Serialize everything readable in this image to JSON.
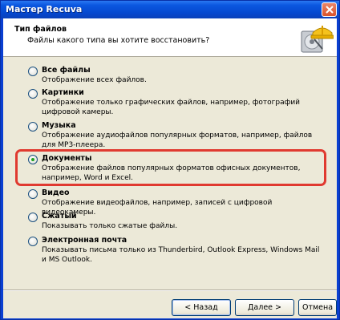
{
  "window": {
    "title": "Мастер Recuva"
  },
  "header": {
    "title": "Тип файлов",
    "subtitle": "Файлы какого типа вы хотите восстановить?"
  },
  "options": [
    {
      "label": "Все файлы",
      "description": "Отображение всех файлов.",
      "checked": false
    },
    {
      "label": "Картинки",
      "description": "Отображение только графических файлов, например, фотографий цифровой камеры.",
      "checked": false
    },
    {
      "label": "Музыка",
      "description": "Отображение аудиофайлов популярных форматов, например, файлов для MP3-плеера.",
      "checked": false
    },
    {
      "label": "Документы",
      "description": "Отображение файлов популярных форматов офисных документов, например, Word и Excel.",
      "checked": true
    },
    {
      "label": "Видео",
      "description": "Отображение видеофайлов, например, записей с цифровой видеокамеры.",
      "checked": false
    },
    {
      "label": "Сжатый",
      "description": "Показывать только сжатые файлы.",
      "checked": false
    },
    {
      "label": "Электронная почта",
      "description": "Показывать письма только из Thunderbird, Outlook Express, Windows Mail и MS Outlook.",
      "checked": false
    }
  ],
  "buttons": {
    "back": "< Назад",
    "next": "Далее >",
    "cancel": "Отмена"
  },
  "icons": {
    "close": "close-icon",
    "wizard": "hard-drive-helmet-icon"
  },
  "colors": {
    "titlebar": "#0548cf",
    "highlight": "#e03a30",
    "face": "#ece9d8"
  }
}
